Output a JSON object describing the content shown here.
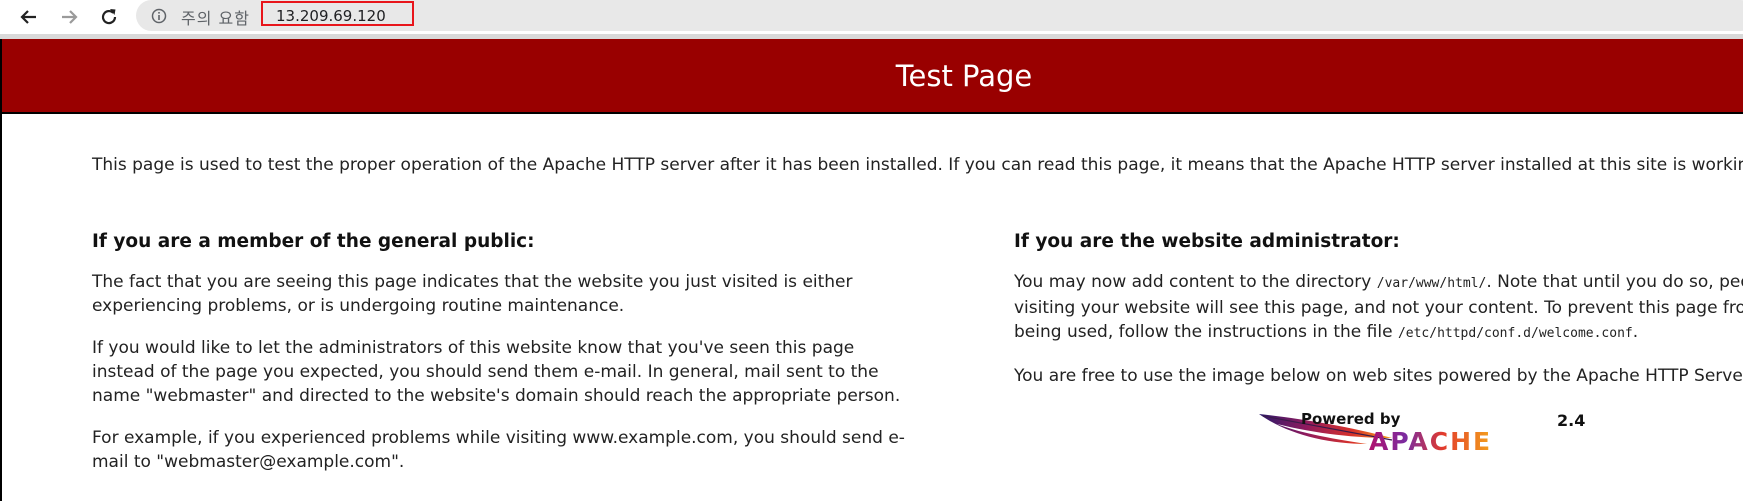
{
  "browser": {
    "security_label": "주의 요함",
    "url": "13.209.69.120",
    "highlight_color": "#e8151b"
  },
  "page": {
    "banner_color": "#990000",
    "title": "Test Page",
    "intro": "This page is used to test the proper operation of the Apache HTTP server after it has been installed. If you can read this page, it means that the Apache HTTP server installed at this site is working pro",
    "public": {
      "heading": "If you are a member of the general public:",
      "p1": "The fact that you are seeing this page indicates that the website you just visited is either experiencing problems, or is undergoing routine maintenance.",
      "p2": "If you would like to let the administrators of this website know that you've seen this page instead of the page you expected, you should send them e-mail. In general, mail sent to the name \"webmaster\" and directed to the website's domain should reach the appropriate person.",
      "p3": "For example, if you experienced problems while visiting www.example.com, you should send e-mail to \"webmaster@example.com\"."
    },
    "admin": {
      "heading": "If you are the website administrator:",
      "p1_line1_a": "You may now add content to the directory ",
      "p1_dir": "/var/www/html/",
      "p1_line1_b": ". Note that until you do so, peo",
      "p1_line2": "visiting your website will see this page, and not your content. To prevent this page from",
      "p1_line3_a": "being used, follow the instructions in the file ",
      "p1_file": "/etc/httpd/conf.d/welcome.conf",
      "p1_line3_b": ".",
      "p2": "You are free to use the image below on web sites powered by the Apache HTTP Server:"
    },
    "logo": {
      "powered_by": "Powered by",
      "version": "2.4",
      "brand": "APACHE"
    }
  }
}
